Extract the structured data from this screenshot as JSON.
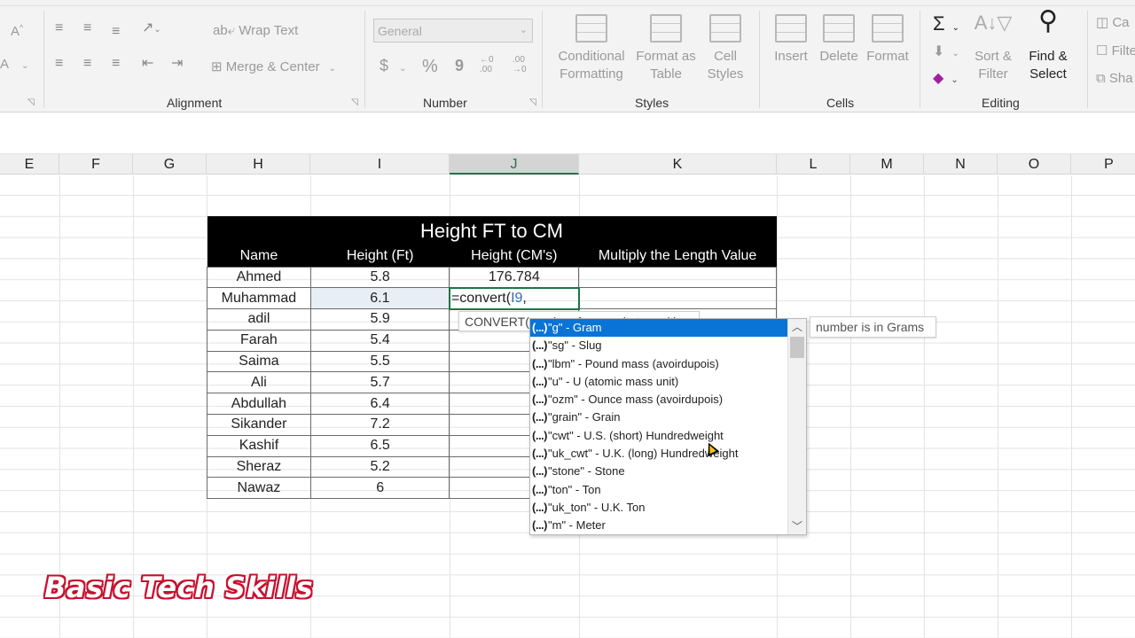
{
  "ribbon": {
    "alignment": {
      "label": "Alignment",
      "wrap_text": "Wrap Text",
      "merge_center": "Merge & Center"
    },
    "number": {
      "label": "Number",
      "format_value": "General",
      "currency": "$",
      "percent": "%",
      "comma": "9",
      "inc_decimal": "←0 .00",
      "dec_decimal": ".00 →0"
    },
    "styles": {
      "label": "Styles",
      "conditional_formatting": "Conditional Formatting",
      "format_as_table": "Format as Table",
      "cell_styles": "Cell Styles"
    },
    "cells": {
      "label": "Cells",
      "insert": "Insert",
      "delete": "Delete",
      "format": "Format"
    },
    "editing": {
      "label": "Editing",
      "autosum": "Σ",
      "sort_filter": "Sort & Filter",
      "find_select": "Find & Select"
    },
    "partial_right": {
      "camera": "Ca",
      "filter": "Filte",
      "share": "Sha"
    },
    "font_partial": {
      "increase": "A",
      "font_color": "A"
    }
  },
  "columns": [
    "E",
    "F",
    "G",
    "H",
    "I",
    "J",
    "K",
    "L",
    "M",
    "N",
    "O",
    "P"
  ],
  "table": {
    "title": "Height FT to CM",
    "headers": [
      "Name",
      "Height (Ft)",
      "Height (CM's)",
      "Multiply the Length Value"
    ],
    "rows": [
      {
        "name": "Ahmed",
        "ft": "5.8",
        "cm": "176.784",
        "mul": ""
      },
      {
        "name": "Muhammad",
        "ft": "6.1",
        "cm": "",
        "mul": ""
      },
      {
        "name": "adil",
        "ft": "5.9",
        "cm": "",
        "mul": ""
      },
      {
        "name": "Farah",
        "ft": "5.4",
        "cm": "",
        "mul": ""
      },
      {
        "name": "Saima",
        "ft": "5.5",
        "cm": "",
        "mul": ""
      },
      {
        "name": "Ali",
        "ft": "5.7",
        "cm": "",
        "mul": ""
      },
      {
        "name": "Abdullah",
        "ft": "6.4",
        "cm": "",
        "mul": ""
      },
      {
        "name": "Sikander",
        "ft": "7.2",
        "cm": "",
        "mul": ""
      },
      {
        "name": "Kashif",
        "ft": "6.5",
        "cm": "",
        "mul": ""
      },
      {
        "name": "Sheraz",
        "ft": "5.2",
        "cm": "",
        "mul": ""
      },
      {
        "name": "Nawaz",
        "ft": "6",
        "cm": "",
        "mul": ""
      }
    ]
  },
  "editor": {
    "formula_prefix": "=convert(",
    "formula_ref": "I9",
    "formula_suffix": ",",
    "tooltip": "CONVERT(number, from_unit, to_unit)"
  },
  "autocomplete": {
    "items": [
      "\"g\" - Gram",
      "\"sg\" - Slug",
      "\"lbm\" - Pound mass (avoirdupois)",
      "\"u\" - U (atomic mass unit)",
      "\"ozm\" - Ounce mass (avoirdupois)",
      "\"grain\" - Grain",
      "\"cwt\" - U.S. (short) Hundredweight",
      "\"uk_cwt\" - U.K. (long) Hundredweight",
      "\"stone\" - Stone",
      "\"ton\" - Ton",
      "\"uk_ton\" - U.K. Ton",
      "\"m\" - Meter"
    ],
    "item_prefix": "(...)",
    "selected_index": 0,
    "description": "number is in Grams"
  },
  "watermark": "Basic Tech Skills"
}
